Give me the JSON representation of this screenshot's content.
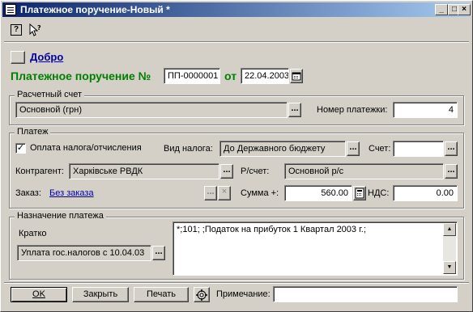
{
  "window": {
    "title": "Платежное поручение-Новый *"
  },
  "toolbar": {
    "help_icon": "?",
    "whatsthis_icon": "arrow-question"
  },
  "header": {
    "dobro_label": "Добро",
    "doc_title": "Платежное поручение №",
    "doc_number": "ПП-0000001",
    "from_label": "от",
    "doc_date": "22.04.2003"
  },
  "account_group": {
    "title": "Расчетный счет",
    "account_value": "Основной (грн)",
    "payment_number_label": "Номер платежки:",
    "payment_number_value": "4"
  },
  "payment_group": {
    "title": "Платеж",
    "tax_checkbox_label": "Оплата налога/отчисления",
    "tax_checked": "✓",
    "tax_type_label": "Вид налога:",
    "tax_type_value": "До Державного бюджету",
    "schet_label": "Счет:",
    "schet_value": "",
    "counterparty_label": "Контрагент:",
    "counterparty_value": "Харківське РВДК",
    "rs_label": "Р/счет:",
    "rs_value": "Основной р/с",
    "order_label": "Заказ:",
    "order_link": "Без заказа",
    "sum_label": "Сумма +:",
    "sum_value": "560.00",
    "vat_label": "НДС:",
    "vat_value": "0.00"
  },
  "purpose_group": {
    "title": "Назначение платежа",
    "short_label": "Кратко",
    "short_value": "Уплата гос.налогов с 10.04.03",
    "purpose_text": "*;101; ;Податок на прибуток 1 Квартал 2003 г.;"
  },
  "footer": {
    "ok_label": "OK",
    "close_label": "Закрыть",
    "print_label": "Печать",
    "note_label": "Примечание:",
    "note_value": ""
  }
}
